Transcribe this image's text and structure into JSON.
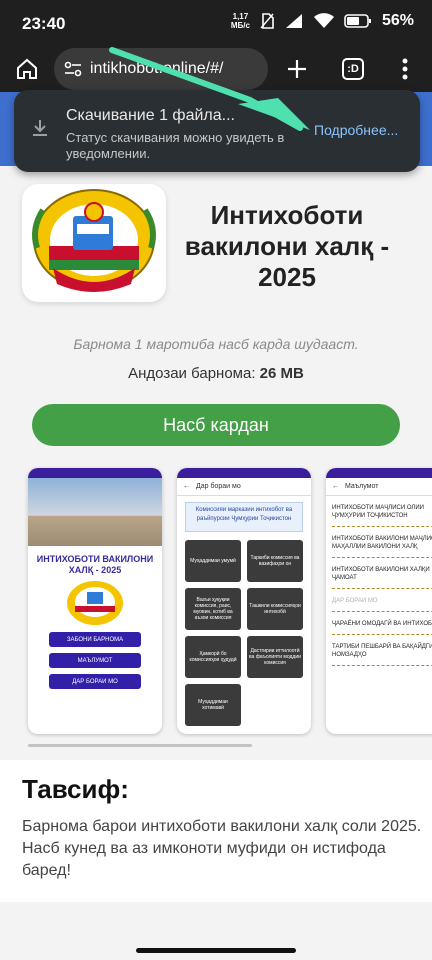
{
  "status_bar": {
    "time": "23:40",
    "speed_value": "1,17",
    "speed_unit": "МБ/с",
    "battery": "56%"
  },
  "browser": {
    "url": "intikhobot.online/#/",
    "tab_count": ":D"
  },
  "download_popup": {
    "title": "Скачивание 1 файла...",
    "subtitle": "Статус скачивания можно увидеть в уведомлении.",
    "link": "Подробнее..."
  },
  "app": {
    "logo_top_text": "КОМИССИЯИ МАРКАЗИИ ИНТИХОБОТ ВА РАЪЙПУРСӢ",
    "logo_bottom_text": "ҶУМҲУРИИ ТОҶИКИСТОН",
    "title": "Интихоботи вакилони халқ - 2025",
    "install_note": "Барнома 1 маротиба насб карда шудааст.",
    "size_label": "Андозаи барнома:",
    "size_value": "26 MB",
    "install_button": "Насб кардан"
  },
  "screenshots": {
    "s1": {
      "title": "ИНТИХОБОТИ ВАКИЛОНИ ХАЛҚ - 2025",
      "buttons": [
        "ЗАБОНИ БАРНОМА",
        "МАЪЛУМОТ",
        "ДАР БОРАИ МО"
      ]
    },
    "s2": {
      "header": "Дар бораи мо",
      "card": "Комиссияи марказии интихобот ва раъйпурсии Ҷумҳурии Тоҷикистон",
      "tiles": [
        "Муҳаддимаи умумӣ",
        "Таркиби комиссия ва вазифаҳои он",
        "Вазъи ҳуқуқии комиссия, раис, муовин, котиб ва аъзои комиссия",
        "Ташкили комиссияҳои интихобӣ",
        "Ҳамкорӣ бо комиссияҳои ҳудудӣ",
        "Дастгирии иттилоотӣ ва фаъолияти моддии комиссия",
        "Муҳаддимаи хотимавӣ"
      ]
    },
    "s3": {
      "header": "Маълумот",
      "items": [
        "ИНТИХОБОТИ МАҶЛИСИ ОЛИИ ҶУМҲУРИИ ТОҶИКИСТОН",
        "ИНТИХОБОТИ ВАКИЛОНИ МАҶЛИСҲОИ МАҲАЛЛИИ ВАКИЛОНИ ХАЛҚ",
        "ИНТИХОБОТИ ВАКИЛОНИ ХАЛҚИ ҶАМОАТ",
        "ДАР БОРАИ МО",
        "ҶАРАЁНИ ОМОДАГӢ ВА ИНТИХОБОТ",
        "ТАРТИБИ ПЕШБАРӢ ВА БАҚАЙДГИРИИ НОМЗАДҲО"
      ]
    }
  },
  "description": {
    "title": "Тавсиф:",
    "text": "Барнома барои интихоботи вакилони халқ соли 2025. Насб кунед ва аз имконоти муфиди он истифода баред!"
  },
  "colors": {
    "install_green": "#43a047",
    "brand_blue": "#3e6fce",
    "link_blue": "#8ac4ff",
    "arrow": "#4fe0b0"
  }
}
